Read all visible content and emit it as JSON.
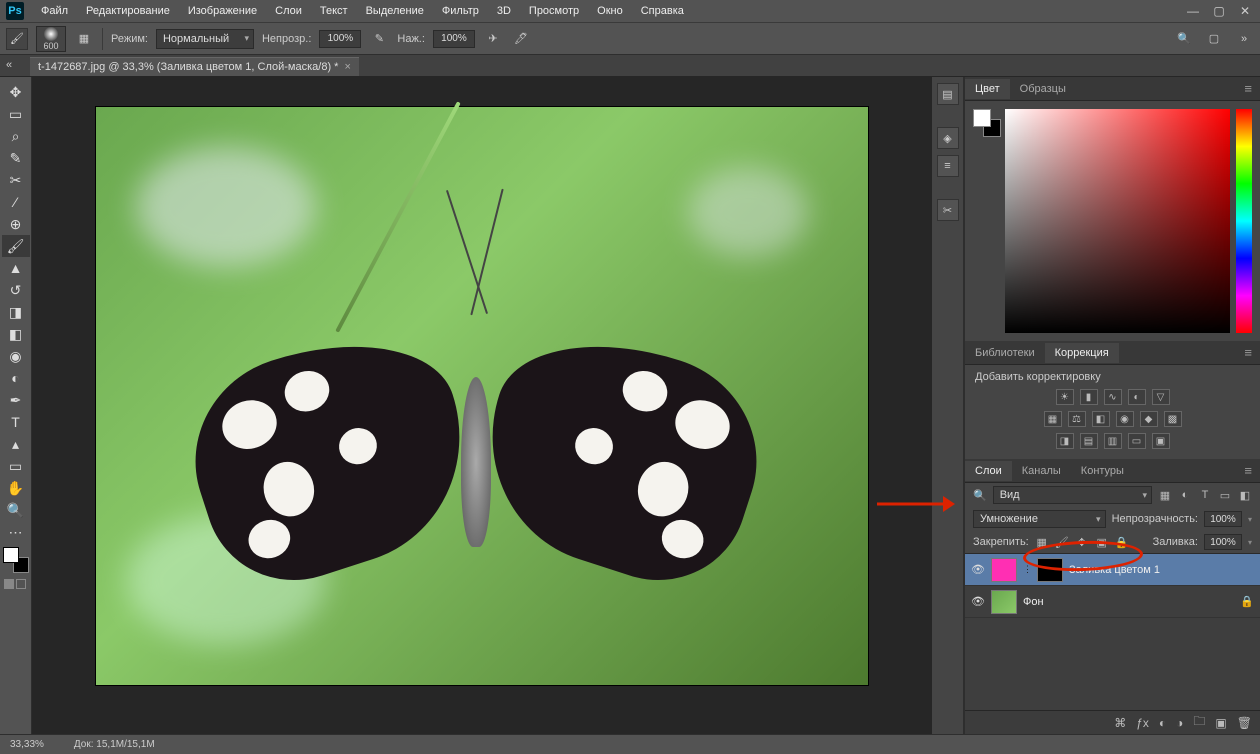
{
  "menu": {
    "items": [
      "Файл",
      "Редактирование",
      "Изображение",
      "Слои",
      "Текст",
      "Выделение",
      "Фильтр",
      "3D",
      "Просмотр",
      "Окно",
      "Справка"
    ]
  },
  "optbar": {
    "brush_size": "600",
    "mode_label": "Режим:",
    "mode_value": "Нормальный",
    "opacity_label": "Непрозр.:",
    "opacity_value": "100%",
    "flow_label": "Наж.:",
    "flow_value": "100%"
  },
  "doc": {
    "tab": "t-1472687.jpg @ 33,3% (Заливка цветом 1, Слой-маска/8) *"
  },
  "panel_tabs": {
    "color": "Цвет",
    "swatches": "Образцы",
    "libraries": "Библиотеки",
    "adjustments": "Коррекция",
    "layers": "Слои",
    "channels": "Каналы",
    "paths": "Контуры"
  },
  "adjustments": {
    "title": "Добавить корректировку"
  },
  "layers": {
    "filter_label": "Вид",
    "blend_mode": "Умножение",
    "opacity_label": "Непрозрачность:",
    "opacity_value": "100%",
    "lock_label": "Закрепить:",
    "fill_label": "Заливка:",
    "fill_value": "100%",
    "items": [
      {
        "name": "Заливка цветом 1",
        "type": "fill",
        "selected": true
      },
      {
        "name": "Фон",
        "type": "bg",
        "locked": true
      }
    ]
  },
  "status": {
    "zoom": "33,33%",
    "doc": "Док: 15,1M/15,1M"
  }
}
